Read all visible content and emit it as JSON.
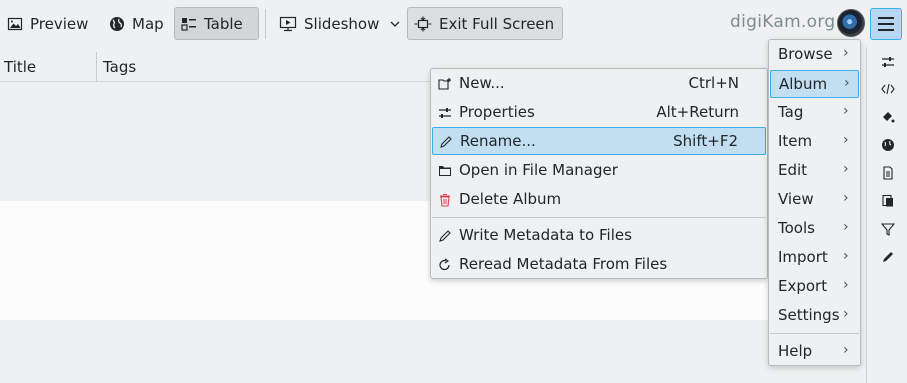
{
  "toolbar": {
    "preview_label": "Preview",
    "map_label": "Map",
    "table_label": "Table",
    "slideshow_label": "Slideshow",
    "exit_fullscreen_label": "Exit Full Screen",
    "brand": "digiKam.org"
  },
  "table": {
    "columns": [
      "Title",
      "Tags"
    ]
  },
  "album_menu": {
    "items": [
      {
        "label": "New...",
        "shortcut": "Ctrl+N",
        "icon": "new-folder-icon"
      },
      {
        "label": "Properties",
        "shortcut": "Alt+Return",
        "icon": "properties-icon"
      },
      {
        "label": "Rename...",
        "shortcut": "Shift+F2",
        "icon": "rename-pencil-icon"
      },
      {
        "label": "Open in File Manager",
        "shortcut": "",
        "icon": "folder-icon"
      },
      {
        "label": "Delete Album",
        "shortcut": "",
        "icon": "trash-icon"
      },
      {
        "label": "Write Metadata to Files",
        "shortcut": "",
        "icon": "pencil-icon"
      },
      {
        "label": "Reread Metadata From Files",
        "shortcut": "",
        "icon": "reload-icon"
      }
    ]
  },
  "main_menu": {
    "items": [
      "Browse",
      "Album",
      "Tag",
      "Item",
      "Edit",
      "View",
      "Tools",
      "Import",
      "Export",
      "Settings",
      "Help"
    ]
  },
  "colors": {
    "highlight": "#c2dff2",
    "highlight_border": "#3daee9",
    "window_bg": "#eff0f1",
    "delete_icon": "#da4453"
  }
}
